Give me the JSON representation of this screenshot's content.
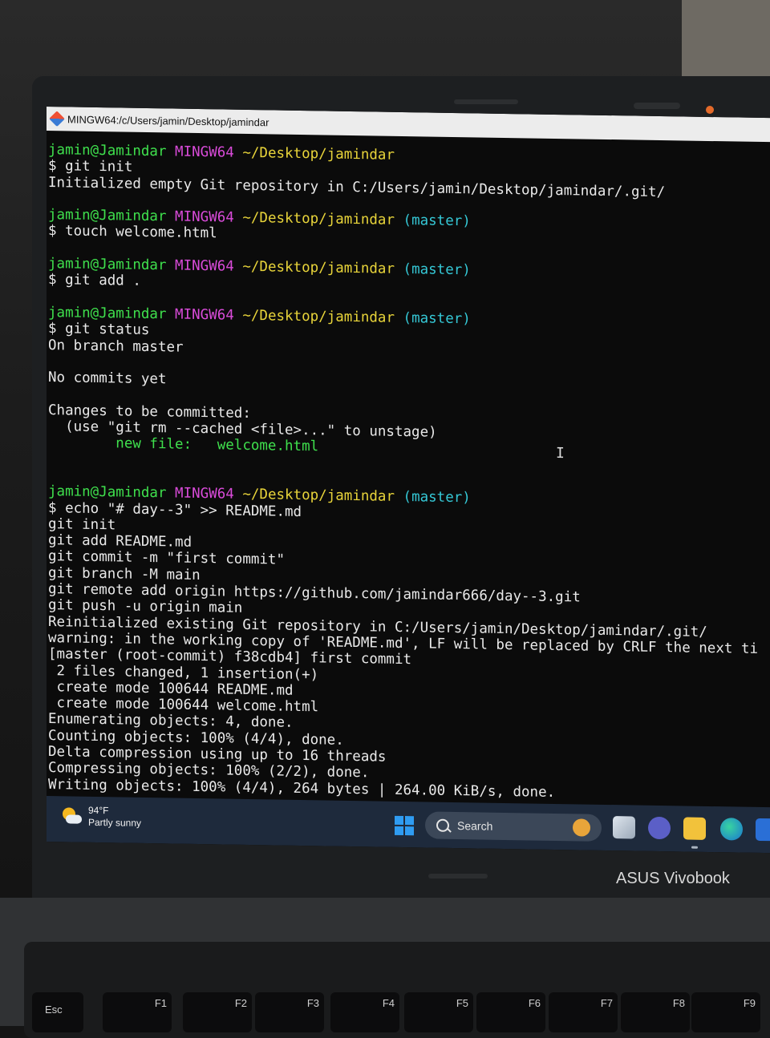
{
  "window": {
    "title": "MINGW64:/c/Users/jamin/Desktop/jamindar"
  },
  "terminal": {
    "lines": [
      [
        {
          "t": "jamin@Jamindar",
          "c": "user"
        },
        {
          "t": " MINGW64",
          "c": "sys"
        },
        {
          "t": " ~/Desktop/jamindar",
          "c": "path"
        }
      ],
      [
        {
          "t": "$ git init",
          "c": "out"
        }
      ],
      [
        {
          "t": "Initialized empty Git repository in C:/Users/jamin/Desktop/jamindar/.git/",
          "c": "out"
        }
      ],
      [
        {
          "t": "",
          "c": "out"
        }
      ],
      [
        {
          "t": "jamin@Jamindar",
          "c": "user"
        },
        {
          "t": " MINGW64",
          "c": "sys"
        },
        {
          "t": " ~/Desktop/jamindar",
          "c": "path"
        },
        {
          "t": " (master)",
          "c": "branch"
        }
      ],
      [
        {
          "t": "$ touch welcome.html",
          "c": "out"
        }
      ],
      [
        {
          "t": "",
          "c": "out"
        }
      ],
      [
        {
          "t": "jamin@Jamindar",
          "c": "user"
        },
        {
          "t": " MINGW64",
          "c": "sys"
        },
        {
          "t": " ~/Desktop/jamindar",
          "c": "path"
        },
        {
          "t": " (master)",
          "c": "branch"
        }
      ],
      [
        {
          "t": "$ git add .",
          "c": "out"
        }
      ],
      [
        {
          "t": "",
          "c": "out"
        }
      ],
      [
        {
          "t": "jamin@Jamindar",
          "c": "user"
        },
        {
          "t": " MINGW64",
          "c": "sys"
        },
        {
          "t": " ~/Desktop/jamindar",
          "c": "path"
        },
        {
          "t": " (master)",
          "c": "branch"
        }
      ],
      [
        {
          "t": "$ git status",
          "c": "out"
        }
      ],
      [
        {
          "t": "On branch master",
          "c": "out"
        }
      ],
      [
        {
          "t": "",
          "c": "out"
        }
      ],
      [
        {
          "t": "No commits yet",
          "c": "out"
        }
      ],
      [
        {
          "t": "",
          "c": "out"
        }
      ],
      [
        {
          "t": "Changes to be committed:",
          "c": "out"
        }
      ],
      [
        {
          "t": "  (use \"git rm --cached <file>...\" to unstage)",
          "c": "out"
        }
      ],
      [
        {
          "t": "        new file:   welcome.html",
          "c": "new"
        }
      ],
      [
        {
          "t": "",
          "c": "out"
        }
      ],
      [
        {
          "t": "",
          "c": "out"
        }
      ],
      [
        {
          "t": "jamin@Jamindar",
          "c": "user"
        },
        {
          "t": " MINGW64",
          "c": "sys"
        },
        {
          "t": " ~/Desktop/jamindar",
          "c": "path"
        },
        {
          "t": " (master)",
          "c": "branch"
        }
      ],
      [
        {
          "t": "$ echo \"# day--3\" >> README.md",
          "c": "out"
        }
      ],
      [
        {
          "t": "git init",
          "c": "out"
        }
      ],
      [
        {
          "t": "git add README.md",
          "c": "out"
        }
      ],
      [
        {
          "t": "git commit -m \"first commit\"",
          "c": "out"
        }
      ],
      [
        {
          "t": "git branch -M main",
          "c": "out"
        }
      ],
      [
        {
          "t": "git remote add origin https://github.com/jamindar666/day--3.git",
          "c": "out"
        }
      ],
      [
        {
          "t": "git push -u origin main",
          "c": "out"
        }
      ],
      [
        {
          "t": "Reinitialized existing Git repository in C:/Users/jamin/Desktop/jamindar/.git/",
          "c": "out"
        }
      ],
      [
        {
          "t": "warning: in the working copy of 'README.md', LF will be replaced by CRLF the next ti",
          "c": "out"
        }
      ],
      [
        {
          "t": "[master (root-commit) f38cdb4] first commit",
          "c": "out"
        }
      ],
      [
        {
          "t": " 2 files changed, 1 insertion(+)",
          "c": "out"
        }
      ],
      [
        {
          "t": " create mode 100644 README.md",
          "c": "out"
        }
      ],
      [
        {
          "t": " create mode 100644 welcome.html",
          "c": "out"
        }
      ],
      [
        {
          "t": "Enumerating objects: 4, done.",
          "c": "out"
        }
      ],
      [
        {
          "t": "Counting objects: 100% (4/4), done.",
          "c": "out"
        }
      ],
      [
        {
          "t": "Delta compression using up to 16 threads",
          "c": "out"
        }
      ],
      [
        {
          "t": "Compressing objects: 100% (2/2), done.",
          "c": "out"
        }
      ],
      [
        {
          "t": "Writing objects: 100% (4/4), 264 bytes | 264.00 KiB/s, done.",
          "c": "out"
        }
      ]
    ]
  },
  "taskbar": {
    "weather_temp": "94°F",
    "weather_desc": "Partly sunny",
    "search_label": "Search",
    "icons": [
      "windows-start-icon",
      "task-view-icon",
      "teams-icon",
      "file-explorer-icon",
      "edge-icon",
      "app-icon"
    ]
  },
  "device": {
    "brand": "ASUS Vivobook"
  },
  "keyboard": {
    "keys": [
      "Esc",
      "F1",
      "F2",
      "F3",
      "F4",
      "F5",
      "F6",
      "F7",
      "F8",
      "F9"
    ]
  },
  "colors": {
    "prompt_user": "#3fe04d",
    "prompt_system": "#d94bd9",
    "prompt_path": "#e8d43a",
    "prompt_branch": "#35c8d6",
    "terminal_bg": "#0b0b0b",
    "taskbar_bg": "#1e2a3c"
  }
}
